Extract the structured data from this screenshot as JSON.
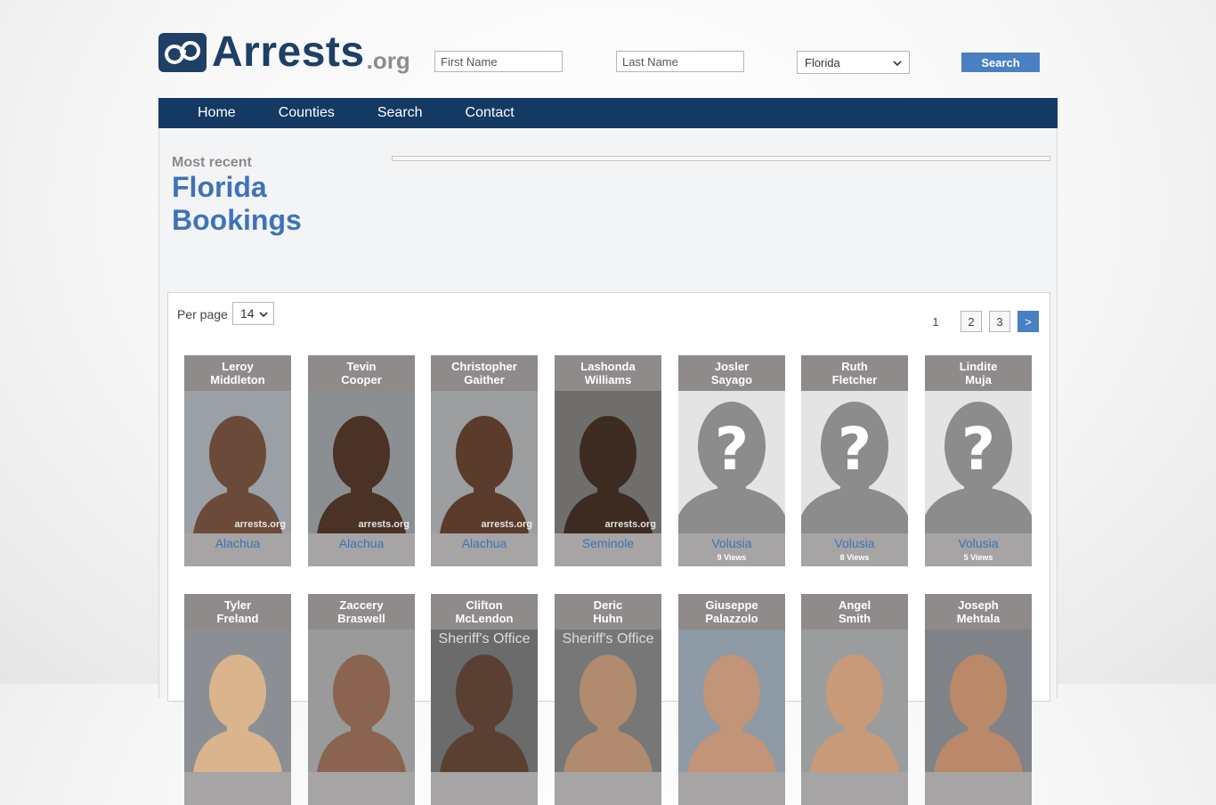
{
  "logo": {
    "main": "Arrests",
    "tld": ".org"
  },
  "search": {
    "first_name_placeholder": "First Name",
    "last_name_placeholder": "Last Name",
    "state_selected": "Florida",
    "button_label": "Search"
  },
  "nav": {
    "items": [
      "Home",
      "Counties",
      "Search",
      "Contact"
    ]
  },
  "heading": {
    "subtitle": "Most recent",
    "line1": "Florida",
    "line2": "Bookings"
  },
  "listing": {
    "per_page_label": "Per page",
    "per_page_value": "14",
    "pages": [
      "1",
      "2",
      "3",
      ">"
    ]
  },
  "bookings": [
    {
      "first": "Leroy",
      "last": "Middleton",
      "county": "Alachua",
      "views": "",
      "photo": "mugshot"
    },
    {
      "first": "Tevin",
      "last": "Cooper",
      "county": "Alachua",
      "views": "",
      "photo": "mugshot"
    },
    {
      "first": "Christopher",
      "last": "Gaither",
      "county": "Alachua",
      "views": "",
      "photo": "mugshot"
    },
    {
      "first": "Lashonda",
      "last": "Williams",
      "county": "Seminole",
      "views": "",
      "photo": "mugshot"
    },
    {
      "first": "Josler",
      "last": "Sayago",
      "county": "Volusia",
      "views": "9 Views",
      "photo": "placeholder"
    },
    {
      "first": "Ruth",
      "last": "Fletcher",
      "county": "Volusia",
      "views": "8 Views",
      "photo": "placeholder"
    },
    {
      "first": "Lindite",
      "last": "Muja",
      "county": "Volusia",
      "views": "5 Views",
      "photo": "placeholder"
    },
    {
      "first": "Tyler",
      "last": "Freland",
      "county": "",
      "views": "",
      "photo": "mugshot"
    },
    {
      "first": "Zaccery",
      "last": "Braswell",
      "county": "",
      "views": "",
      "photo": "mugshot"
    },
    {
      "first": "Clifton",
      "last": "McLendon",
      "county": "",
      "views": "",
      "photo": "mugshot"
    },
    {
      "first": "Deric",
      "last": "Huhn",
      "county": "",
      "views": "",
      "photo": "mugshot"
    },
    {
      "first": "Giuseppe",
      "last": "Palazzolo",
      "county": "",
      "views": "",
      "photo": "mugshot"
    },
    {
      "first": "Angel",
      "last": "Smith",
      "county": "",
      "views": "",
      "photo": "mugshot"
    },
    {
      "first": "Joseph",
      "last": "Mehtala",
      "county": "",
      "views": "",
      "photo": "mugshot"
    }
  ],
  "photo_overlays": {
    "watermark": "arrests.org",
    "sheriff": "Sheriff's Office"
  },
  "colors": {
    "brand": "#1e3f66",
    "nav": "#143963",
    "accent": "#4a7fc1",
    "link": "#3f73b8"
  }
}
